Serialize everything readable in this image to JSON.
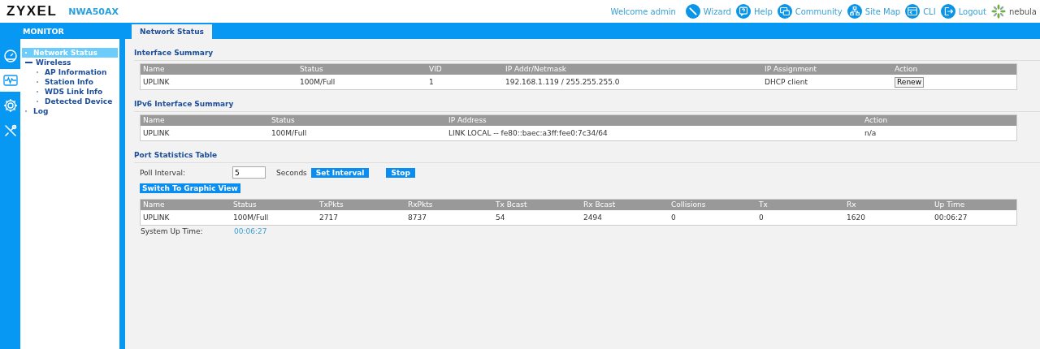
{
  "header": {
    "brand": "ZYXEL",
    "model": "NWA50AX",
    "welcome": "Welcome admin",
    "links": [
      {
        "kind": "wizard",
        "label": "Wizard"
      },
      {
        "kind": "help",
        "label": "Help"
      },
      {
        "kind": "community",
        "label": "Community"
      },
      {
        "kind": "sitemap",
        "label": "Site Map"
      },
      {
        "kind": "cli",
        "label": "CLI"
      },
      {
        "kind": "logout",
        "label": "Logout"
      },
      {
        "kind": "nebula",
        "label": "nebula"
      }
    ]
  },
  "sidebar": {
    "title": "MONITOR",
    "modes": [
      {
        "kind": "dashboard",
        "selected": false
      },
      {
        "kind": "monitor",
        "selected": true
      },
      {
        "kind": "configuration",
        "selected": false
      },
      {
        "kind": "maintenance",
        "selected": false
      }
    ],
    "items": [
      {
        "label": "Network Status",
        "selected": true
      },
      {
        "label": "Wireless",
        "selected": false,
        "expanded": true,
        "children": [
          {
            "label": "AP Information",
            "selected": false
          },
          {
            "label": "Station Info",
            "selected": false
          },
          {
            "label": "WDS Link Info",
            "selected": false
          },
          {
            "label": "Detected Device",
            "selected": false
          }
        ]
      },
      {
        "label": "Log",
        "selected": false
      }
    ]
  },
  "tabs": [
    {
      "label": "Network Status",
      "selected": true
    }
  ],
  "interface_summary": {
    "title": "Interface Summary",
    "columns": [
      "Name",
      "Status",
      "VID",
      "IP Addr/Netmask",
      "IP Assignment",
      "Action"
    ],
    "rows": [
      [
        "UPLINK",
        "100M/Full",
        "1",
        "192.168.1.119 / 255.255.255.0",
        "DHCP client",
        {
          "button": "Renew"
        }
      ]
    ]
  },
  "ipv6_summary": {
    "title": "IPv6 Interface Summary",
    "columns": [
      "Name",
      "Status",
      "IP Address",
      "Action"
    ],
    "rows": [
      [
        "UPLINK",
        "100M/Full",
        "LINK LOCAL -- fe80::baec:a3ff:fee0:7c34/64",
        "n/a"
      ]
    ]
  },
  "port_statistics": {
    "title": "Port Statistics Table",
    "poll_label": "Poll Interval:",
    "poll_value": "5",
    "poll_unit": "Seconds",
    "set_button": "Set Interval",
    "stop_button": "Stop",
    "switch_button": "Switch To Graphic View",
    "columns": [
      "Name",
      "Status",
      "TxPkts",
      "RxPkts",
      "Tx Bcast",
      "Rx Bcast",
      "Collisions",
      "Tx",
      "Rx",
      "Up Time"
    ],
    "rows": [
      [
        "UPLINK",
        "100M/Full",
        "2717",
        "8737",
        "54",
        "2494",
        "0",
        "0",
        "1620",
        "00:06:27"
      ]
    ],
    "uptime_label": "System Up Time:",
    "uptime_value": "00:06:27"
  }
}
